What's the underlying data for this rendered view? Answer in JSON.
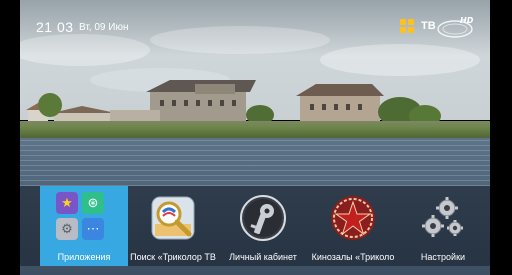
{
  "status": {
    "time": "21 03",
    "date": "Вт, 09 Июн"
  },
  "brand": {
    "logo_text": "TB",
    "logo_colors": {
      "grid": "#ffc21a",
      "text": "#ffffff"
    }
  },
  "menu": {
    "items": [
      {
        "label": "Приложения",
        "icon": "apps-grid-icon",
        "active": true
      },
      {
        "label": "Поиск «Триколор ТВ",
        "icon": "search-magnifier-icon",
        "active": false
      },
      {
        "label": "Личный кабинет",
        "icon": "key-icon",
        "active": false
      },
      {
        "label": "Кинозалы «Триколо",
        "icon": "film-star-icon",
        "active": false
      },
      {
        "label": "Настройки",
        "icon": "gears-icon",
        "active": false
      }
    ],
    "accent_color": "#37a8e2"
  }
}
